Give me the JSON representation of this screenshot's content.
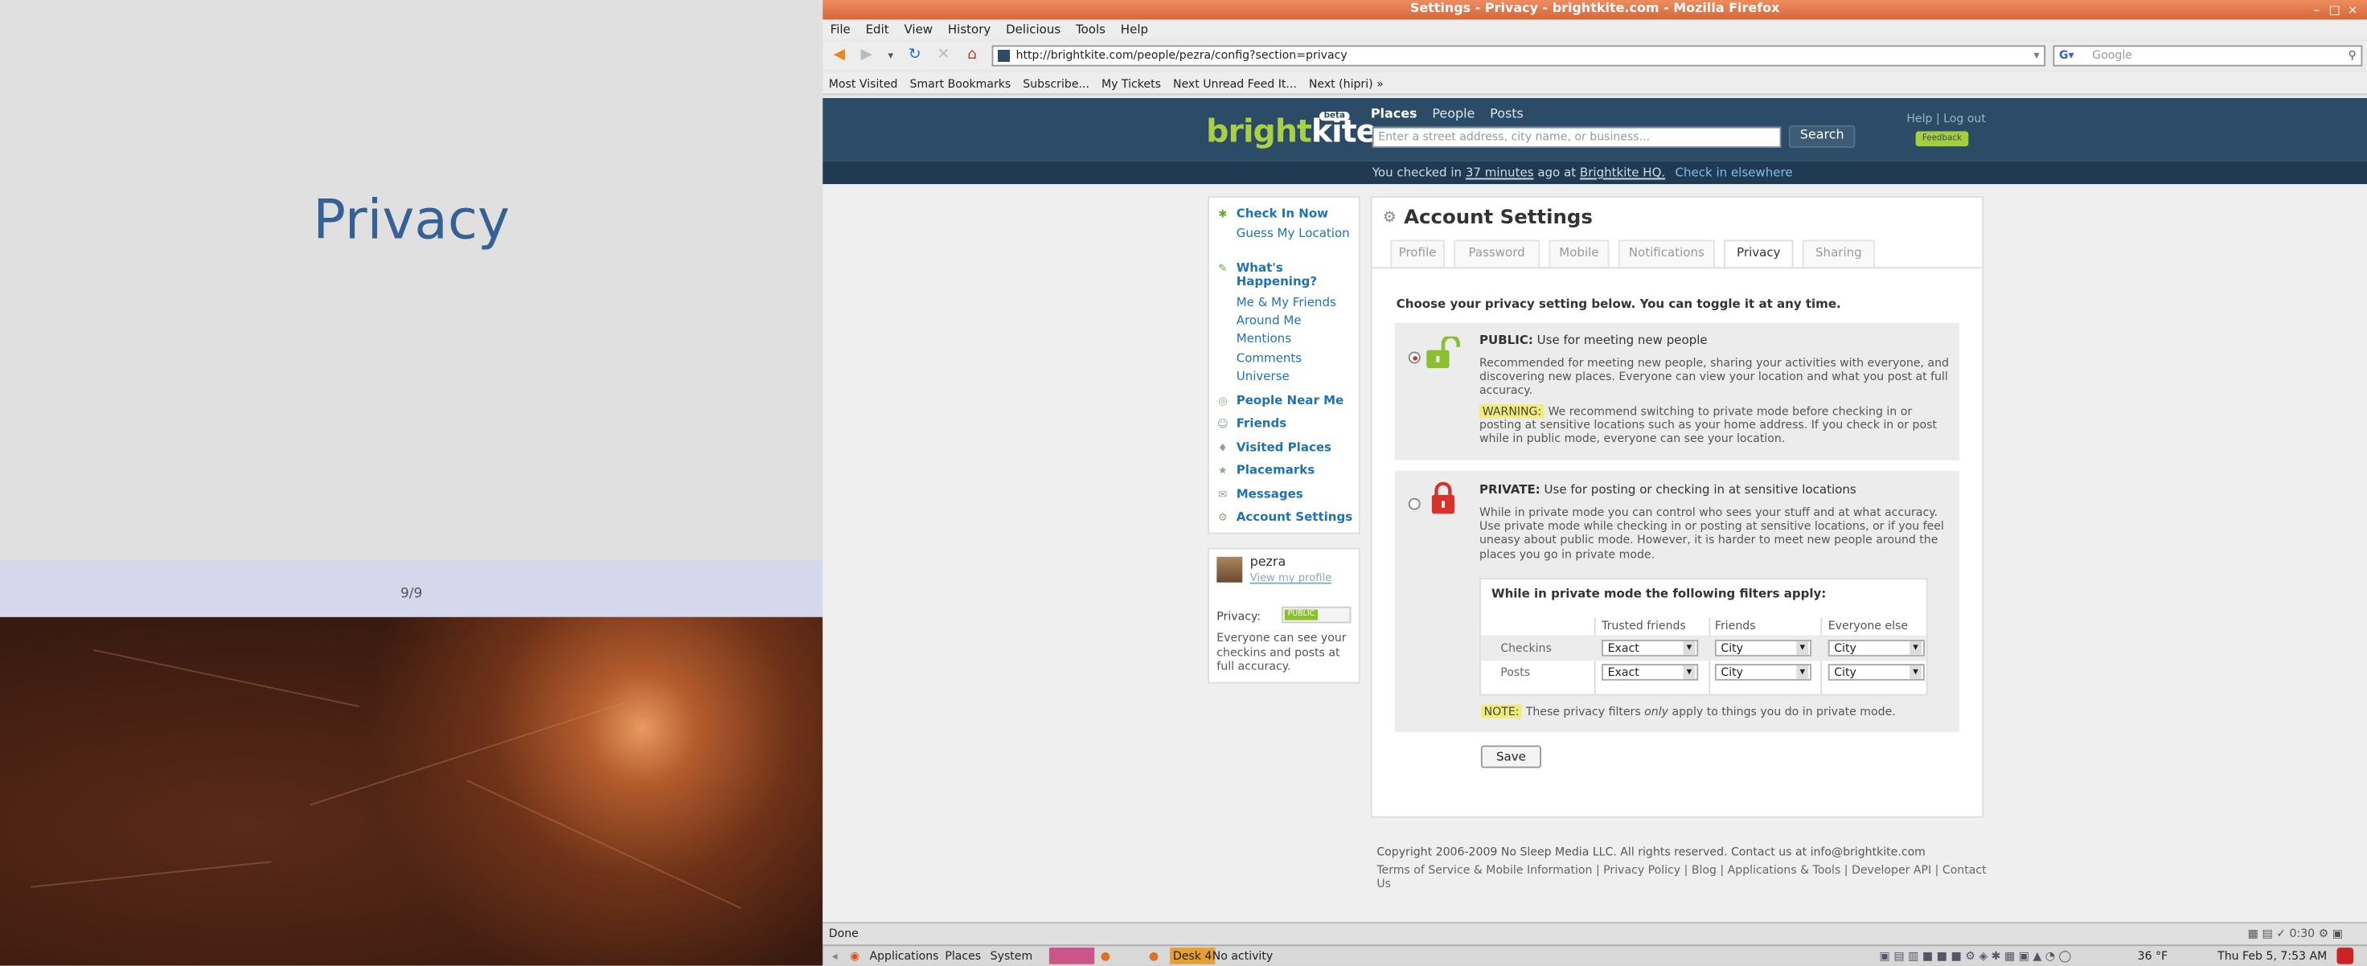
{
  "slide": {
    "title": "Privacy",
    "counter": "9/9"
  },
  "window": {
    "title": "Settings - Privacy - brightkite.com - Mozilla Firefox"
  },
  "menu": [
    "File",
    "Edit",
    "View",
    "History",
    "Delicious",
    "Tools",
    "Help"
  ],
  "url": "http://brightkite.com/people/pezra/config?section=privacy",
  "search_placeholder": "Google",
  "bookmarks": [
    "Most Visited",
    "Smart Bookmarks",
    "Subscribe...",
    "My Tickets",
    "Next Unread Feed It...",
    "Next (hipri) »"
  ],
  "status": "Done",
  "bk": {
    "logo_a": "bright",
    "logo_b": "kite",
    "beta": "beta",
    "tabs": [
      "Places",
      "People",
      "Posts"
    ],
    "search_placeholder": "Enter a street address, city name, or business...",
    "search_button": "Search",
    "help": "Help",
    "logout": "Log out",
    "feedback": "Feedback",
    "checkin_pre": "You checked in",
    "checkin_time": "37 minutes",
    "checkin_mid": "ago at",
    "checkin_place": "Brightkite HQ.",
    "checkin_else": "Check in elsewhere"
  },
  "nav": {
    "checkin_now": "Check In Now",
    "guess": "Guess My Location",
    "whats": "What's Happening?",
    "me_friends": "Me & My Friends",
    "around": "Around Me",
    "mentions": "Mentions",
    "comments": "Comments",
    "universe": "Universe",
    "people_near": "People Near Me",
    "friends": "Friends",
    "visited": "Visited Places",
    "placemarks": "Placemarks",
    "messages": "Messages",
    "account": "Account Settings"
  },
  "user": {
    "name": "pezra",
    "profile_link": "View my profile",
    "privacy_label": "Privacy:",
    "privacy_badge": "PUBLIC",
    "privacy_note": "Everyone can see your checkins and posts at full accuracy."
  },
  "settings": {
    "title": "Account Settings",
    "tabs": [
      "Profile",
      "Password",
      "Mobile",
      "Notifications",
      "Privacy",
      "Sharing"
    ],
    "choose": "Choose your privacy setting below. You can toggle it at any time.",
    "public_label": "PUBLIC:",
    "public_sub": "Use for meeting new people",
    "public_desc": "Recommended for meeting new people, sharing your activities with everyone, and discovering new places. Everyone can view your location and what you post at full accuracy.",
    "warning_label": "WARNING:",
    "warning_text": "We recommend switching to private mode before checking in or posting at sensitive locations such as your home address. If you check in or post while in public mode, everyone can see your location.",
    "private_label": "PRIVATE:",
    "private_sub": "Use for posting or checking in at sensitive locations",
    "private_desc": "While in private mode you can control who sees your stuff and at what accuracy. Use private mode while checking in or posting at sensitive locations, or if you feel uneasy about public mode. However, it is harder to meet new people around the places you go in private mode.",
    "filters_title": "While in private mode the following filters apply:",
    "filter_cols": [
      "Trusted friends",
      "Friends",
      "Everyone else"
    ],
    "filter_rows": [
      {
        "label": "Checkins",
        "values": [
          "Exact",
          "City",
          "City"
        ]
      },
      {
        "label": "Posts",
        "values": [
          "Exact",
          "City",
          "City"
        ]
      }
    ],
    "note_label": "NOTE:",
    "note_pre": "These privacy filters",
    "note_em": "only",
    "note_post": "apply to things you do in private mode.",
    "save": "Save"
  },
  "footer": {
    "copyright": "Copyright 2006-2009 No Sleep Media LLC. All rights reserved. Contact us at info@brightkite.com",
    "links": "Terms of Service & Mobile Information | Privacy Policy | Blog | Applications & Tools | Developer API | Contact Us"
  },
  "taskbar": {
    "apps": "Applications",
    "places": "Places",
    "system": "System",
    "desk": "Desk 4",
    "activity": "No activity",
    "temp": "36 °F",
    "clock": "Thu Feb 5, 7:53 AM",
    "tray_time": "0:30"
  },
  "colors": {
    "bk_header": "#2b4b66",
    "accent": "#1e73b0",
    "bk_green": "#a8cf45",
    "titlebar": "#e07a4a"
  }
}
